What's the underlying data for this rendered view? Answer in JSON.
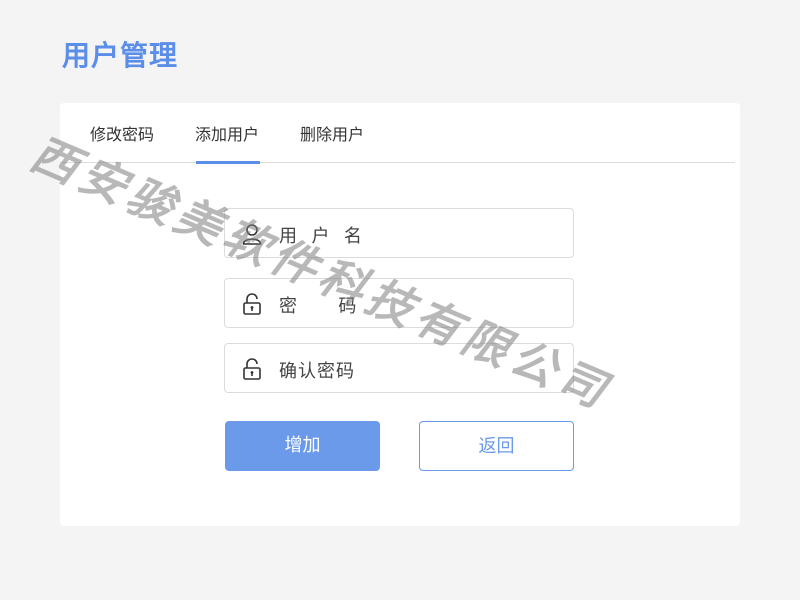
{
  "page": {
    "title": "用户管理"
  },
  "tabs": [
    {
      "label": "修改密码",
      "active": false
    },
    {
      "label": "添加用户",
      "active": true
    },
    {
      "label": "删除用户",
      "active": false
    }
  ],
  "form": {
    "username_placeholder": "用  户  名",
    "password_placeholder": "密      码",
    "confirm_placeholder": "确认密码",
    "username_icon": "user-icon",
    "password_icon": "lock-icon",
    "confirm_icon": "lock-icon"
  },
  "buttons": {
    "add_label": "增加",
    "back_label": "返回"
  },
  "watermark": {
    "text": "西安骏美软件科技有限公司"
  },
  "colors": {
    "accent": "#5b8ee8",
    "button_primary": "#6a9ae9",
    "background": "#f4f4f4"
  }
}
